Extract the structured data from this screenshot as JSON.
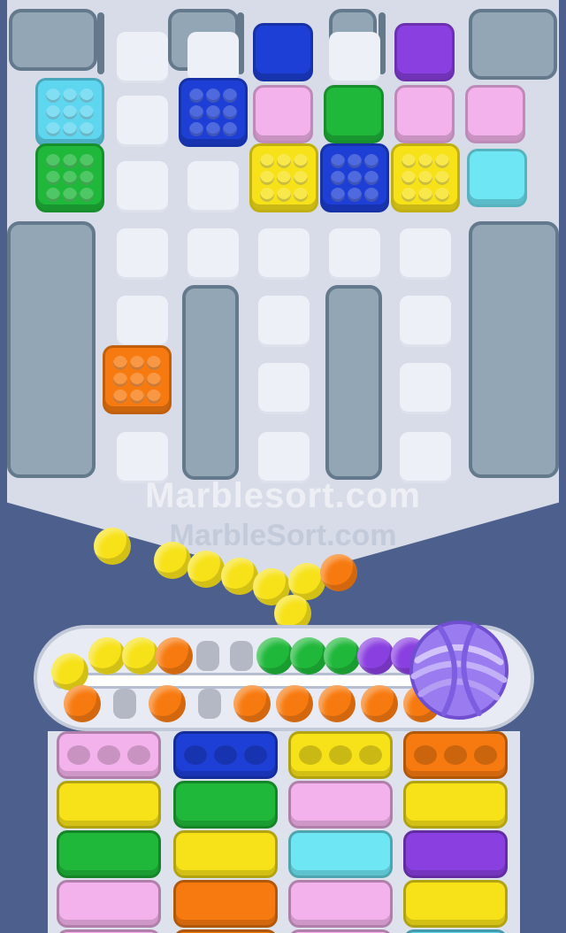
{
  "watermarks": {
    "primary": "Marblesort.com",
    "secondary": "MarbleSort.com"
  },
  "colors": {
    "cyan": "#5fd6f0",
    "green": "#1fb83a",
    "blue": "#1e3fd6",
    "purple": "#8a3fe0",
    "pink": "#f4b2ec",
    "yellow": "#f7e21a",
    "orange": "#f77a10",
    "light_cyan": "#6ee6f4"
  },
  "board": {
    "blocks": [
      {
        "color": "cyan",
        "kind": "dotted"
      },
      {
        "color": "green",
        "kind": "dotted"
      },
      {
        "color": "blue",
        "kind": "dotted"
      },
      {
        "color": "blue",
        "kind": "plain"
      },
      {
        "color": "pink",
        "kind": "plain"
      },
      {
        "color": "yellow",
        "kind": "dotted"
      },
      {
        "color": "green",
        "kind": "plain"
      },
      {
        "color": "blue",
        "kind": "dotted"
      },
      {
        "color": "purple",
        "kind": "plain"
      },
      {
        "color": "pink",
        "kind": "plain"
      },
      {
        "color": "yellow",
        "kind": "dotted"
      },
      {
        "color": "pink",
        "kind": "plain"
      },
      {
        "color": "light_cyan",
        "kind": "plain"
      },
      {
        "color": "orange",
        "kind": "dotted"
      }
    ]
  },
  "falling_marbles": [
    "yellow",
    "yellow",
    "yellow",
    "yellow",
    "yellow",
    "yellow",
    "yellow",
    "orange"
  ],
  "conveyor": {
    "top_row": [
      "yellow",
      "yellow",
      "orange",
      "empty",
      "empty",
      "green",
      "green",
      "green",
      "purple",
      "purple"
    ],
    "bottom_row": [
      "orange",
      "empty",
      "orange",
      "empty",
      "orange",
      "orange",
      "orange",
      "orange",
      "orange"
    ]
  },
  "collector_icon": "purple-yarn-ball",
  "columns": [
    {
      "slots": [
        "pink",
        "yellow",
        "green",
        "pink",
        "pink"
      ]
    },
    {
      "slots": [
        "blue",
        "green",
        "yellow",
        "orange",
        "orange"
      ]
    },
    {
      "slots": [
        "yellow",
        "pink",
        "light_cyan",
        "pink",
        "pink"
      ]
    },
    {
      "slots": [
        "orange",
        "yellow",
        "purple",
        "yellow",
        "cyan"
      ]
    }
  ]
}
